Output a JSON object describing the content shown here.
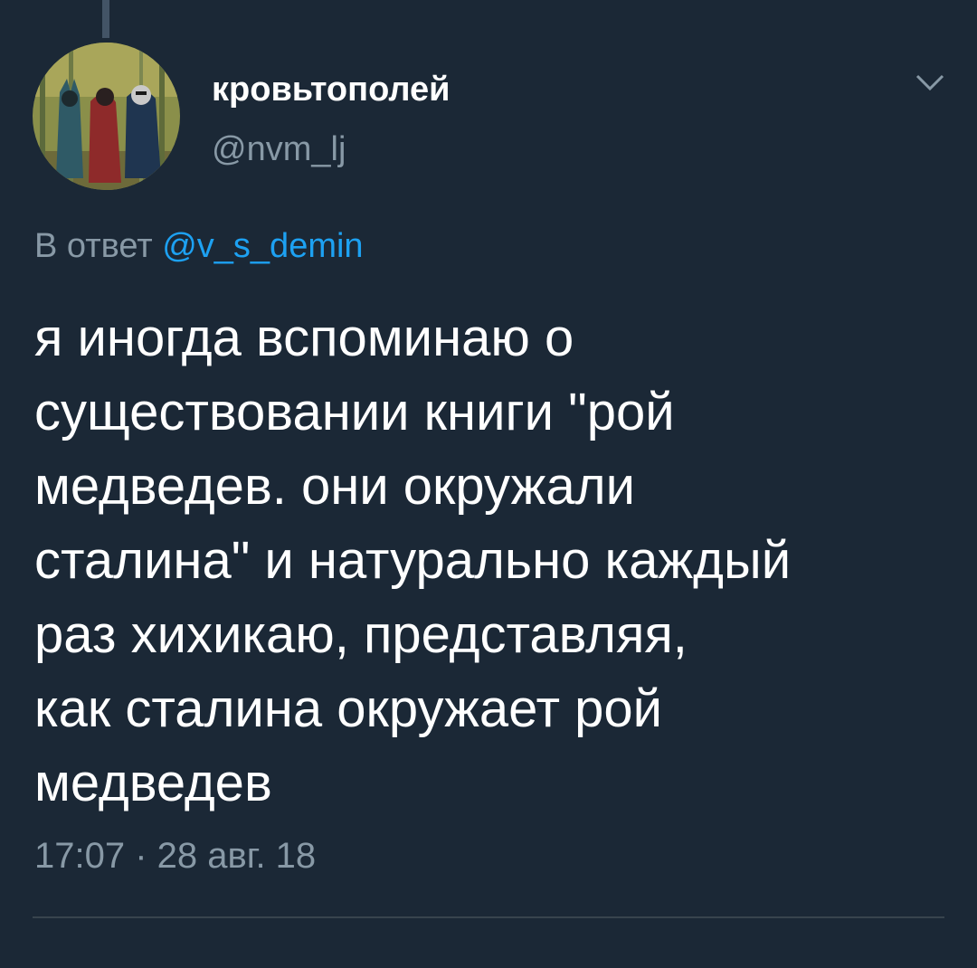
{
  "tweet": {
    "display_name": "кровьтополей",
    "handle": "@nvm_lj",
    "reply_prefix": "В ответ",
    "reply_mention": "@v_s_demin",
    "text_lines": [
      "я иногда вспоминаю о",
      "существовании книги \"рой",
      "медведев. они окружали",
      "сталина\" и натурально каждый",
      "раз хихикаю, представляя,",
      "как сталина окружает рой",
      "медведев"
    ],
    "timestamp": "17:07 · 28 авг. 18"
  },
  "icons": {
    "avatar": "avatar-image",
    "menu": "chevron-down-icon"
  },
  "colors": {
    "background": "#1b2836",
    "primary_text": "#ffffff",
    "secondary_text": "#8899a6",
    "link": "#1da1f2",
    "divider": "#38444d"
  }
}
